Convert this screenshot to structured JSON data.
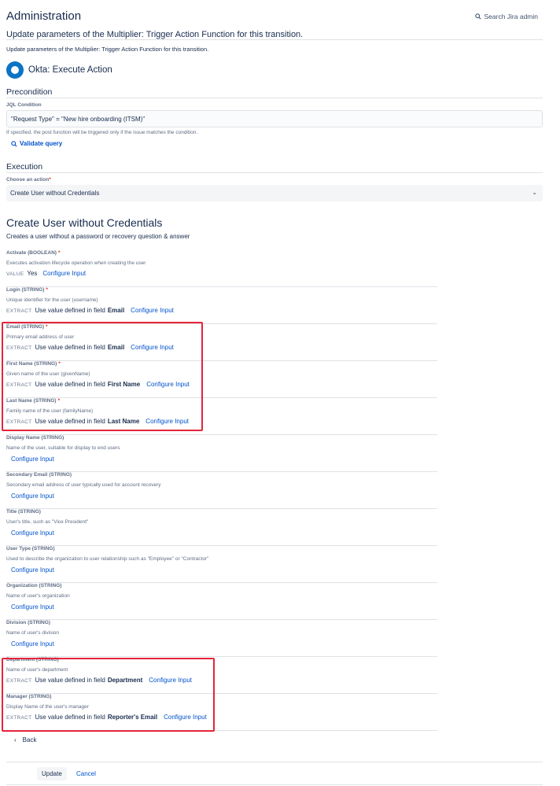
{
  "header": {
    "title": "Administration",
    "search_label": "Search Jira admin",
    "search_icon": "search-icon"
  },
  "page": {
    "subtitle": "Update parameters of the Multiplier: Trigger Action Function for this transition.",
    "description": "Update parameters of the Multiplier: Trigger Action Function for this transition."
  },
  "integration": {
    "title": "Okta: Execute Action",
    "brand_color": "#0b74c4"
  },
  "precondition": {
    "heading": "Precondition",
    "jql_label": "JQL Condition",
    "jql_value": "\"Request Type\" = \"New hire onboarding (ITSM)\"",
    "help": "If specified, the post function will be triggered only if the issue matches the condition.",
    "validate_label": "Validate query"
  },
  "execution": {
    "heading": "Execution",
    "action_label": "Choose an action",
    "action_value": "Create User without Credentials"
  },
  "action": {
    "title": "Create User without Credentials",
    "description": "Creates a user without a password or recovery question & answer",
    "configure_label": "Configure Input",
    "fields": [
      {
        "label": "Activate (BOOLEAN)",
        "required": "*",
        "description": "Executes activation lifecycle operation when creating the user",
        "type": "VALUE",
        "value_text": "Yes",
        "field": ""
      },
      {
        "label": "Login (STRING)",
        "required": "*",
        "description": "Unique identifier for the user (username)",
        "type": "EXTRACT",
        "value_text": "Use value defined in field",
        "field": "Email"
      },
      {
        "label": "Email (STRING)",
        "required": "*",
        "description": "Primary email address of user",
        "type": "EXTRACT",
        "value_text": "Use value defined in field",
        "field": "Email"
      },
      {
        "label": "First Name (STRING)",
        "required": "*",
        "description": "Given name of the user (givenName)",
        "type": "EXTRACT",
        "value_text": "Use value defined in field",
        "field": "First Name"
      },
      {
        "label": "Last Name (STRING)",
        "required": "*",
        "description": "Family name of the user (familyName)",
        "type": "EXTRACT",
        "value_text": "Use value defined in field",
        "field": "Last Name"
      },
      {
        "label": "Display Name (STRING)",
        "required": "",
        "description": "Name of the user, suitable for display to end users",
        "type": "",
        "value_text": "",
        "field": ""
      },
      {
        "label": "Secondary Email (STRING)",
        "required": "",
        "description": "Secondary email address of user typically used for account recovery",
        "type": "",
        "value_text": "",
        "field": ""
      },
      {
        "label": "Title (STRING)",
        "required": "",
        "description": "User's title, such as \"Vice President\"",
        "type": "",
        "value_text": "",
        "field": ""
      },
      {
        "label": "User Type (STRING)",
        "required": "",
        "description": "Used to describe the organization to user relationship such as \"Employee\" or \"Contractor\"",
        "type": "",
        "value_text": "",
        "field": ""
      },
      {
        "label": "Organization (STRING)",
        "required": "",
        "description": "Name of user's organization",
        "type": "",
        "value_text": "",
        "field": ""
      },
      {
        "label": "Division (STRING)",
        "required": "",
        "description": "Name of user's division",
        "type": "",
        "value_text": "",
        "field": ""
      },
      {
        "label": "Department (STRING)",
        "required": "",
        "description": "Name of user's department",
        "type": "EXTRACT",
        "value_text": "Use value defined in field",
        "field": "Department"
      },
      {
        "label": "Manager (STRING)",
        "required": "",
        "description": "Display Name of the user's manager",
        "type": "EXTRACT",
        "value_text": "Use value defined in field",
        "field": "Reporter's Email"
      }
    ]
  },
  "nav": {
    "back_label": "Back"
  },
  "footer": {
    "update_label": "Update",
    "cancel_label": "Cancel"
  },
  "colors": {
    "link": "#0052cc",
    "highlight": "#e5243b"
  }
}
